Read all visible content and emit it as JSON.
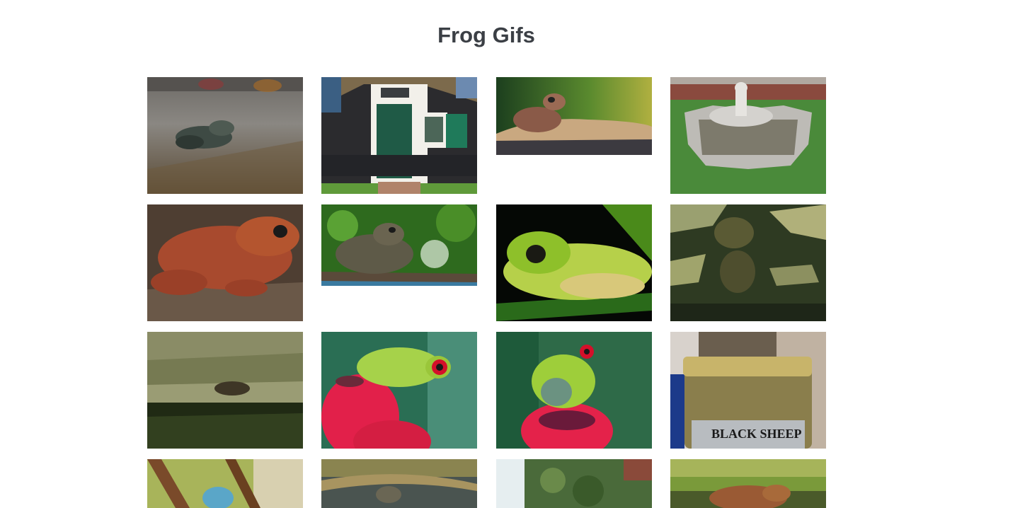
{
  "page": {
    "title": "Frog Gifs"
  },
  "gallery": {
    "items": [
      {
        "subject": "frog on wet pavement",
        "ratio": 0.75
      },
      {
        "subject": "thatched cottage with green door",
        "ratio": 0.75
      },
      {
        "subject": "frog on rock against green background",
        "ratio": 0.5
      },
      {
        "subject": "garden fountain",
        "ratio": 0.75
      },
      {
        "subject": "red-brown frog on soil",
        "ratio": 0.75
      },
      {
        "subject": "toad on log",
        "ratio": 0.52
      },
      {
        "subject": "green tree frog on leaf",
        "ratio": 0.75
      },
      {
        "subject": "frogs on mossy stone",
        "ratio": 0.75
      },
      {
        "subject": "frog on bark by water",
        "ratio": 0.75
      },
      {
        "subject": "red-eyed tree frog on red flower",
        "ratio": 0.75
      },
      {
        "subject": "red-eyed tree frog on flower",
        "ratio": 0.75
      },
      {
        "subject": "jar with Black Sheep label",
        "ratio": 0.75,
        "label_text": "BLACK SHEEP"
      },
      {
        "subject": "blue frog on branches",
        "ratio": 0.75
      },
      {
        "subject": "frog in murky water",
        "ratio": 0.75
      },
      {
        "subject": "mossy wall",
        "ratio": 0.75
      },
      {
        "subject": "brown frog in grass",
        "ratio": 0.75
      }
    ]
  },
  "colors": {
    "title": "#3b3f45",
    "background": "#ffffff"
  }
}
